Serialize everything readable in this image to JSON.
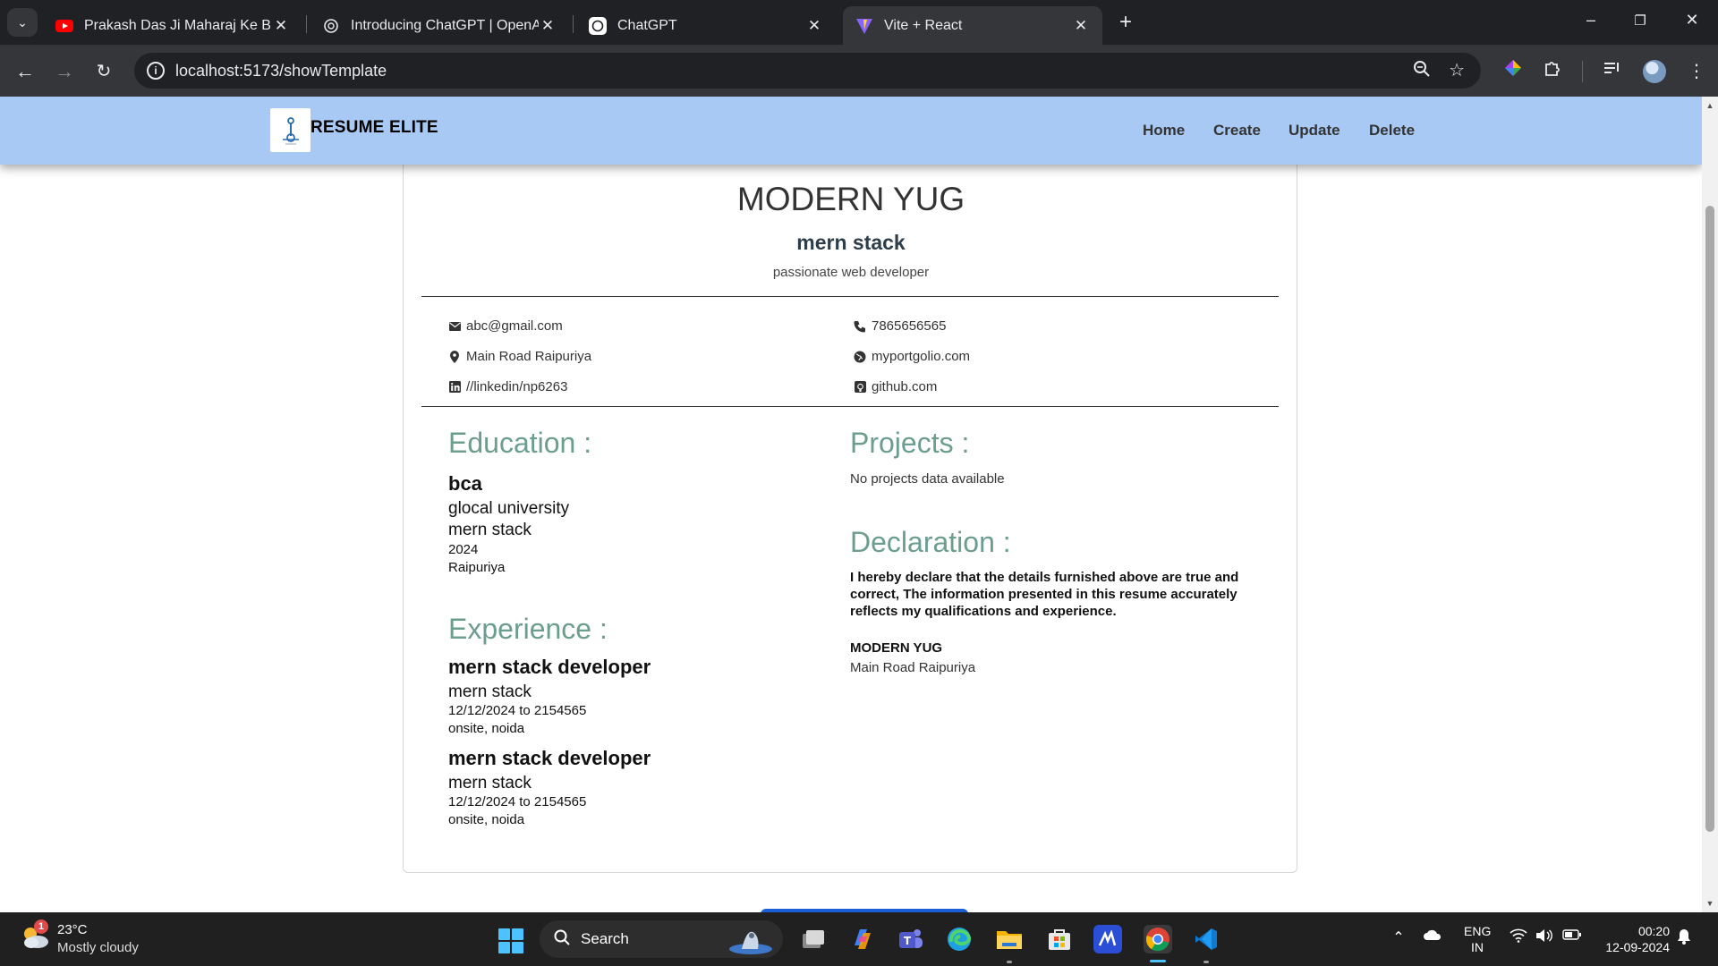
{
  "browser": {
    "tabs": [
      {
        "title": "Prakash Das Ji Maharaj Ke Bhajan",
        "icon": "youtube-icon"
      },
      {
        "title": "Introducing ChatGPT | OpenAI",
        "icon": "openai-icon"
      },
      {
        "title": "ChatGPT",
        "icon": "chatgpt-icon"
      },
      {
        "title": "Vite + React",
        "icon": "vite-icon"
      }
    ],
    "active_tab_index": 3,
    "url": "localhost:5173/showTemplate"
  },
  "app": {
    "brand": "RESUME ELITE",
    "nav": [
      "Home",
      "Create",
      "Update",
      "Delete"
    ]
  },
  "resume": {
    "name": "MODERN YUG",
    "role": "mern stack",
    "tagline": "passionate web developer",
    "contacts": {
      "email": "abc@gmail.com",
      "phone": "7865656565",
      "address": "Main Road Raipuriya",
      "portfolio": "myportgolio.com",
      "linkedin": "//linkedin/np6263",
      "github": "github.com"
    },
    "education_title": "Education :",
    "education": {
      "degree": "bca",
      "institution": "glocal university",
      "field": "mern stack",
      "year": "2024",
      "location": "Raipuriya"
    },
    "experience_title": "Experience :",
    "experience": [
      {
        "title": "mern stack developer",
        "company": "mern stack",
        "dates": "12/12/2024 to 2154565",
        "location": "onsite, noida"
      },
      {
        "title": "mern stack developer",
        "company": "mern stack",
        "dates": "12/12/2024 to 2154565",
        "location": "onsite, noida"
      }
    ],
    "projects_title": "Projects :",
    "projects_empty": "No projects data available",
    "declaration_title": "Declaration :",
    "declaration_text": "I hereby declare that the details furnished above are true and correct, The information presented in this resume accurately reflects my qualifications and experience.",
    "signature_name": "MODERN YUG",
    "signature_address": "Main Road Raipuriya"
  },
  "taskbar": {
    "weather_badge": "1",
    "temperature": "23°C",
    "weather": "Mostly cloudy",
    "search_label": "Search",
    "lang_top": "ENG",
    "lang_bottom": "IN",
    "time": "00:20",
    "date": "12-09-2024"
  },
  "colors": {
    "app_nav_bg": "#a9c9f5",
    "section_title": "#6b9e8f",
    "primary_button": "#1a5fd6"
  }
}
